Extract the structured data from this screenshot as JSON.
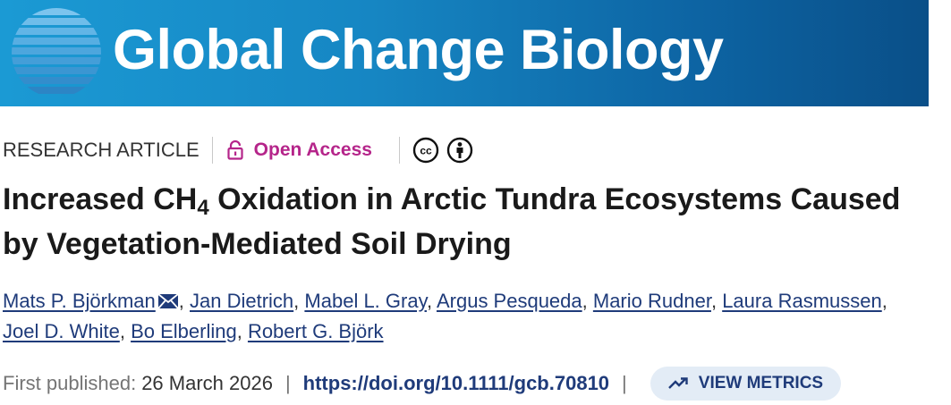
{
  "journal": {
    "title": "Global Change Biology"
  },
  "meta": {
    "article_type": "RESEARCH ARTICLE",
    "access": "Open Access",
    "license_icons": [
      "creative-commons-icon",
      "attribution-icon"
    ]
  },
  "article": {
    "title_part1": "Increased CH",
    "title_sub": "4",
    "title_part2": " Oxidation in Arctic Tundra Ecosystems Caused",
    "title_line2": "by Vegetation-Mediated Soil Drying"
  },
  "authors": [
    "Mats P. Björkman",
    "Jan Dietrich",
    "Mabel L. Gray",
    "Argus Pesqueda",
    "Mario Rudner",
    "Laura Rasmussen",
    "Joel D. White",
    "Bo Elberling",
    "Robert G. Björk"
  ],
  "publication": {
    "first_published_label": "First published:",
    "date": "26 March 2026",
    "doi": "https://doi.org/10.1111/gcb.70810",
    "metrics_button": "VIEW METRICS"
  },
  "colors": {
    "accent_link": "#1f3b7a",
    "open_access": "#b5258a",
    "banner_start": "#1b9ad4",
    "banner_end": "#0a4f88"
  }
}
